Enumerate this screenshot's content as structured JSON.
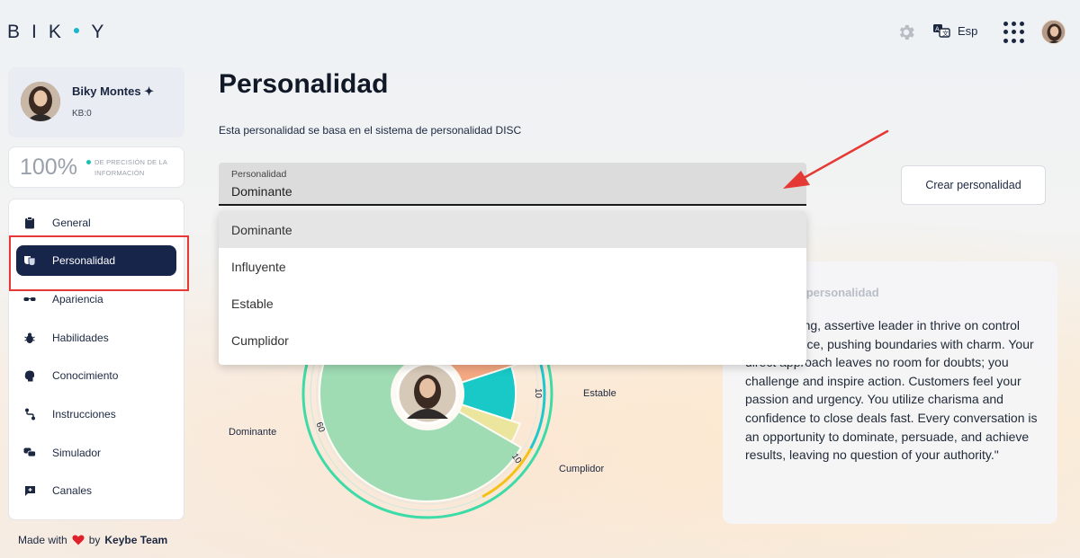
{
  "header": {
    "logo": "BIKY",
    "language": "Esp"
  },
  "profile": {
    "name": "Biky Montes ✦",
    "kb": "KB:0"
  },
  "precision": {
    "value": "100%",
    "label": "DE PRECISIÓN DE LA INFORMACIÓN"
  },
  "sidebar": {
    "items": [
      {
        "label": "General",
        "icon": "clipboard-icon"
      },
      {
        "label": "Personalidad",
        "icon": "masks-icon"
      },
      {
        "label": "Apariencia",
        "icon": "glasses-icon"
      },
      {
        "label": "Habilidades",
        "icon": "bug-icon"
      },
      {
        "label": "Conocimiento",
        "icon": "head-icon"
      },
      {
        "label": "Instrucciones",
        "icon": "route-icon"
      },
      {
        "label": "Simulador",
        "icon": "chat-icon"
      },
      {
        "label": "Canales",
        "icon": "message-plus-icon"
      }
    ],
    "active_index": 1
  },
  "footer": {
    "made_with": "Made with",
    "by": "by",
    "team": "Keybe Team"
  },
  "main": {
    "title": "Personalidad",
    "subtitle": "Esta personalidad se basa en el sistema de personalidad DISC",
    "select": {
      "label": "Personalidad",
      "value": "Dominante",
      "options": [
        "Dominante",
        "Influyente",
        "Estable",
        "Cumplidor"
      ],
      "selected_index": 0
    },
    "create_button": "Crear personalidad",
    "description": {
      "title": "ón de la personalidad",
      "text": "commanding, assertive leader in thrive on control and influence, pushing boundaries with charm. Your direct approach leaves no room for doubts; you challenge and inspire action. Customers feel your passion and urgency. You utilize charisma and confidence to close deals fast. Every conversation is an opportunity to dominate, persuade, and achieve results, leaving no question of your authority.\""
    }
  },
  "chart_data": {
    "type": "pie",
    "categories": [
      "Dominante",
      "Influyente",
      "Estable",
      "Cumplidor"
    ],
    "values": [
      60,
      20,
      10,
      10
    ],
    "labels": {
      "dominante": "Dominante",
      "estable": "Estable",
      "cumplidor": "Cumplidor",
      "val_dominante": "60",
      "val_estable": "10",
      "val_cumplidor": "10"
    },
    "colors": {
      "Dominante": "#9fdcb4",
      "Influyente": "#f4a882",
      "Estable": "#19c9c7",
      "Cumplidor": "#ebe59e",
      "outer_ring": "#3ddba8",
      "accent_arc": "#f2c21b"
    }
  },
  "colors": {
    "accent": "#17254a",
    "highlight": "#e53935",
    "arrow": "#e53935"
  }
}
